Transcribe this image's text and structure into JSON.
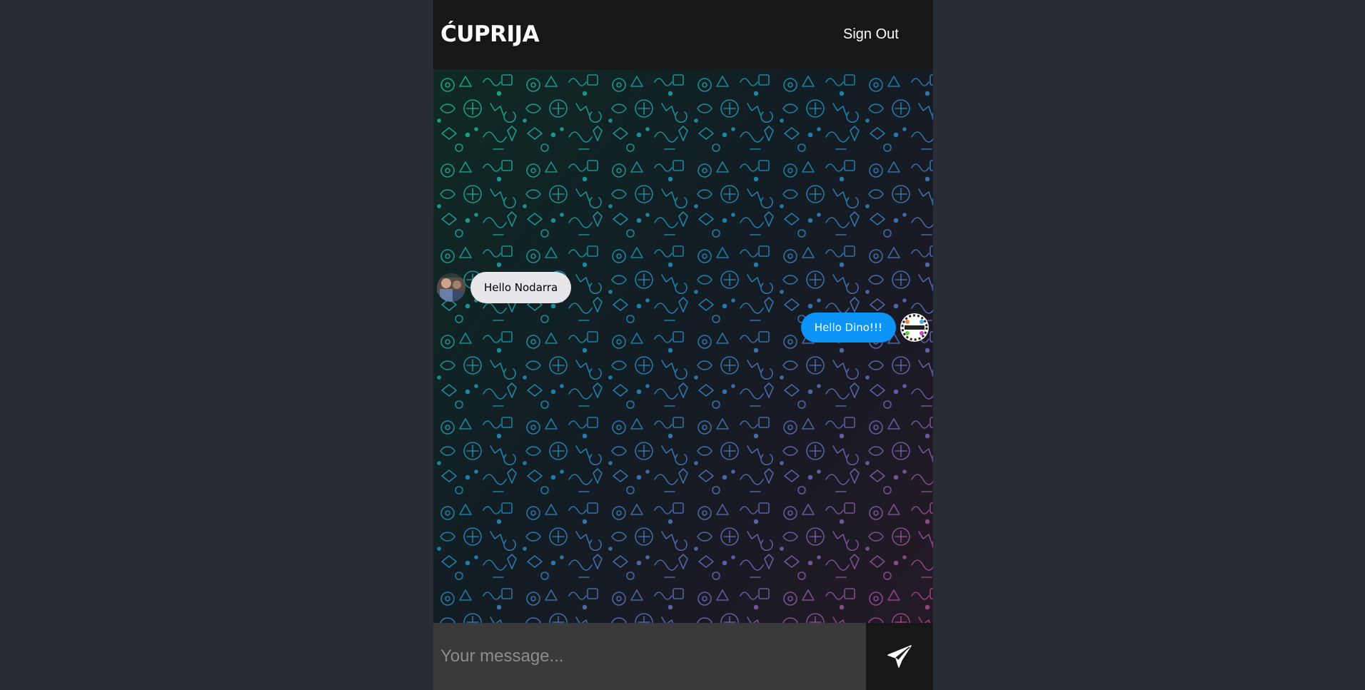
{
  "app": {
    "title": "ĆUPRIJA",
    "sign_out_label": "Sign Out"
  },
  "messages": [
    {
      "type": "received",
      "text": "Hello Nodarra",
      "avatar": "user-avatar-photo"
    },
    {
      "type": "sent",
      "text": "Hello Dino!!!",
      "avatar": "user-avatar-logo"
    }
  ],
  "composer": {
    "placeholder": "Your message...",
    "value": "",
    "send_icon": "paper-plane-icon"
  },
  "colors": {
    "page_bg": "#282c34",
    "header_bg": "#181717",
    "received_bubble": "#e5e5ea",
    "sent_bubble": "#0b93f6",
    "input_bg": "#3a3a3a"
  }
}
